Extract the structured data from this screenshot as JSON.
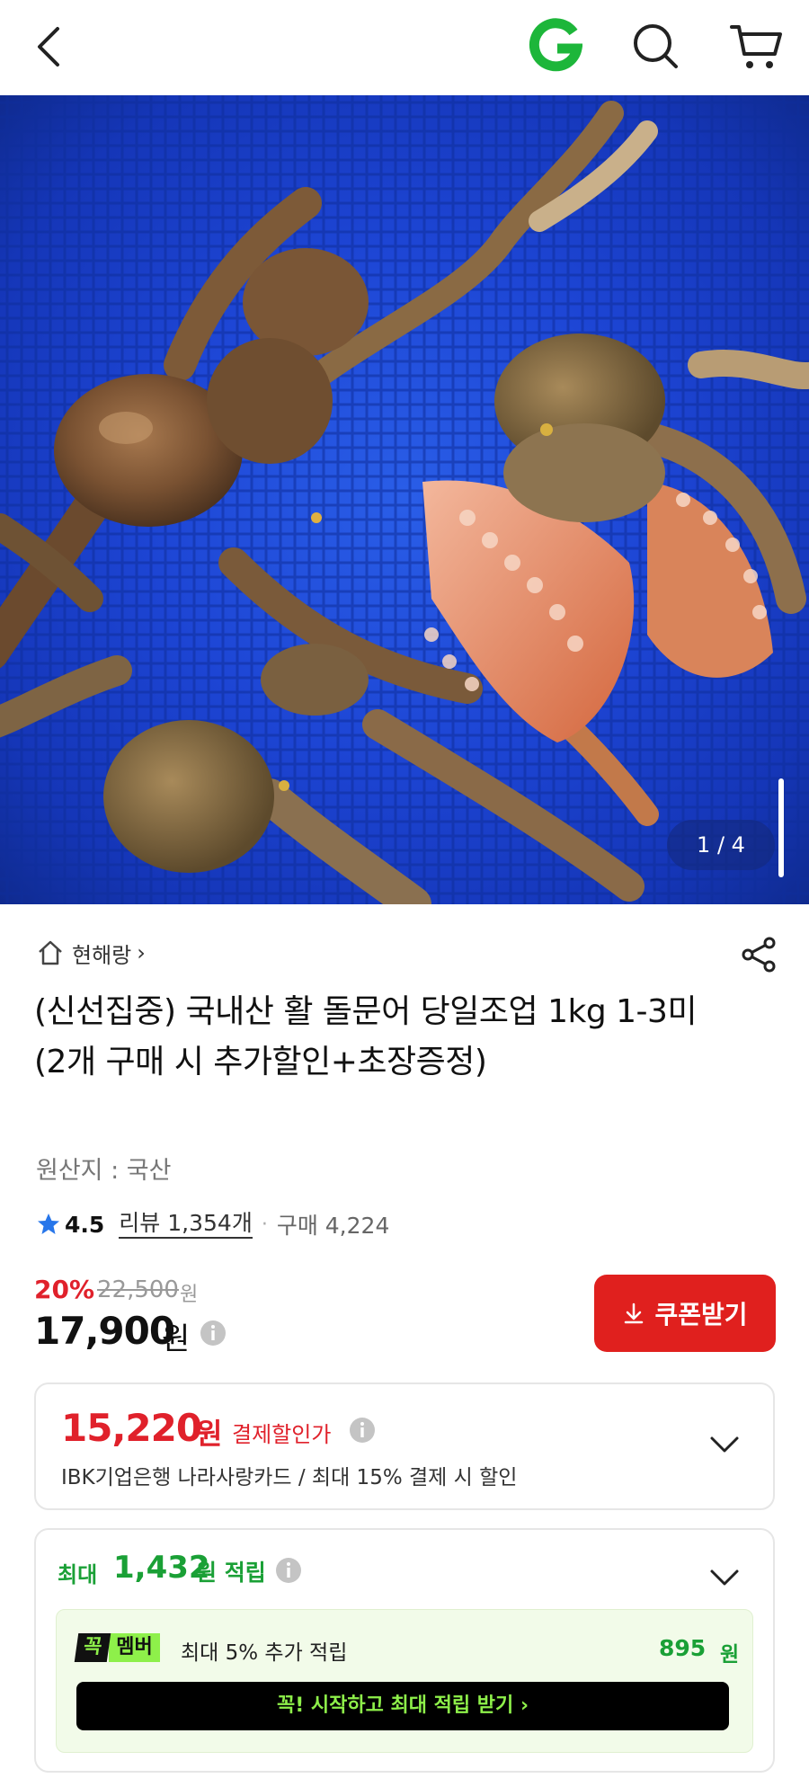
{
  "header": {
    "back_icon": "chevron-left-icon",
    "logo_icon": "gmarket-g-logo",
    "search_icon": "search-icon",
    "cart_icon": "cart-icon"
  },
  "gallery": {
    "counter": "1 / 4"
  },
  "store": {
    "name": "현해랑",
    "chevron": "›"
  },
  "product": {
    "title": "(신선집중) 국내산 활 돌문어 당일조업 1kg 1-3미 (2개 구매 시 추가할인+초장증정)",
    "origin": "원산지 : 국산"
  },
  "rating": {
    "score": "4.5",
    "reviews": "리뷰 1,354개",
    "dot": "·",
    "purchases": "구매 4,224"
  },
  "price": {
    "discount_pct": "20%",
    "original": "22,500",
    "original_unit": "원",
    "current": "17,900",
    "current_unit": "원",
    "coupon_label": "쿠폰받기"
  },
  "payment_discount": {
    "amount": "15,220",
    "unit": "원",
    "label": "결제할인가",
    "desc": "IBK기업은행 나라사랑카드 / 최대 15% 결제 시 할인"
  },
  "points": {
    "prefix": "최대",
    "amount": "1,432",
    "suffix": "원 적립",
    "member_badge_a": "꼭",
    "member_badge_b": "멤버",
    "member_text": "최대 5% 추가 적립",
    "member_amount": "895",
    "member_unit": "원",
    "member_button": "꼭! 시작하고 최대 적립 받기 ›"
  },
  "colors": {
    "accent_red": "#e0212b",
    "green": "#1aa036",
    "member_green": "#8ef04a"
  }
}
